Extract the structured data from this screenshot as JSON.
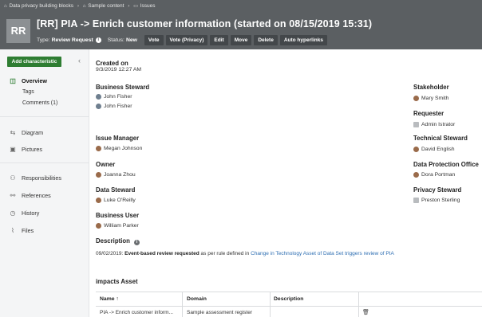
{
  "breadcrumb": [
    "Data privacy building blocks",
    "Sample content",
    "Issues"
  ],
  "asset": {
    "type_abbr": "RR",
    "title": "[RR] PIA -> Enrich customer information (started on 08/15/2019 15:31)",
    "type_label": "Type:",
    "type_value": "Review Request",
    "status_label": "Status:",
    "status_value": "New"
  },
  "actions": [
    "Vote",
    "Vote (Privacy)",
    "Edit",
    "Move",
    "Delete",
    "Auto hyperlinks"
  ],
  "sidebar": {
    "add_button": "Add characteristic",
    "collapse": "‹",
    "overview": "Overview",
    "tags": "Tags",
    "comments": "Comments (1)",
    "diagram": "Diagram",
    "pictures": "Pictures",
    "responsibilities": "Responsibilities",
    "references": "References",
    "history": "History",
    "files": "Files"
  },
  "fields": {
    "created_on_label": "Created on",
    "created_on_value": "9/3/2019 12:27 AM",
    "business_steward_label": "Business Steward",
    "business_stewards": [
      "John Fisher",
      "John Fisher"
    ],
    "issue_manager_label": "Issue Manager",
    "issue_manager": "Megan Johnson",
    "owner_label": "Owner",
    "owner": "Joanna Zhou",
    "data_steward_label": "Data Steward",
    "data_steward": "Luke O'Reilly",
    "business_user_label": "Business User",
    "business_user": "William Parker",
    "stakeholder_label": "Stakeholder",
    "stakeholder": "Mary Smith",
    "requester_label": "Requester",
    "requester": "Admin Istrator",
    "technical_steward_label": "Technical Steward",
    "technical_steward": "David English",
    "dpo_label": "Data Protection Office",
    "dpo": "Dora Portman",
    "privacy_steward_label": "Privacy Steward",
    "privacy_steward": "Preston Sterling"
  },
  "description": {
    "label": "Description",
    "date": "09/02/2019:",
    "bold_text": "Event-based review requested",
    "text": " as per rule defined in ",
    "link_text": "Change in Technology Asset of Data Set triggers review of PIA"
  },
  "impacts": {
    "title": "impacts Asset",
    "headers": [
      "Name ↑",
      "Domain",
      "Description"
    ],
    "row": [
      "PIA -> Enrich customer inform...",
      "Sample assessment register",
      ""
    ]
  },
  "colors": {
    "header_bg": "#5b5f62",
    "accent_green": "#2e7d32",
    "link": "#2f6fb3"
  }
}
